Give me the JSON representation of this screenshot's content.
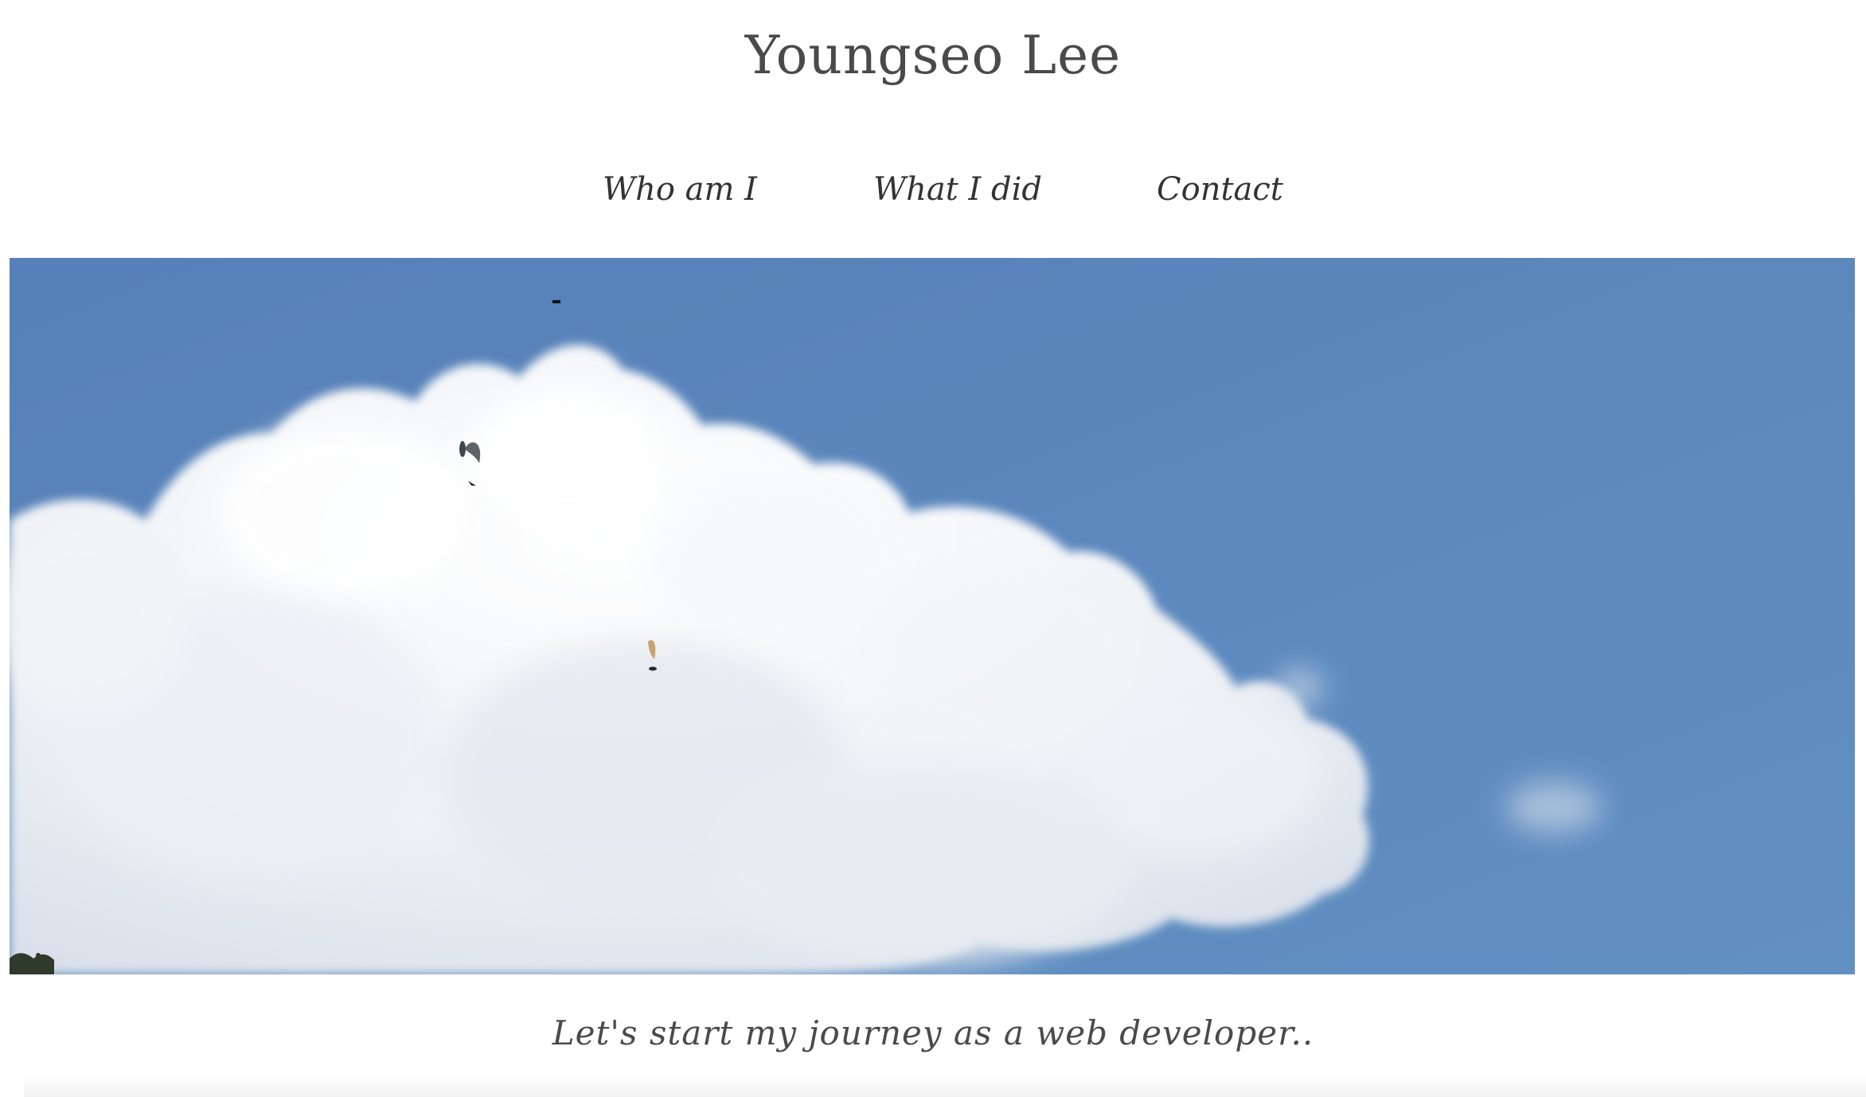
{
  "site": {
    "title": "Youngseo Lee"
  },
  "nav": {
    "items": [
      {
        "label": "Who am I"
      },
      {
        "label": "What I did"
      },
      {
        "label": "Contact"
      }
    ]
  },
  "hero": {
    "sky_color": "#5b86bb",
    "cloud_color": "#f4f6f9"
  },
  "tagline": "Let's start my journey as a web developer.."
}
